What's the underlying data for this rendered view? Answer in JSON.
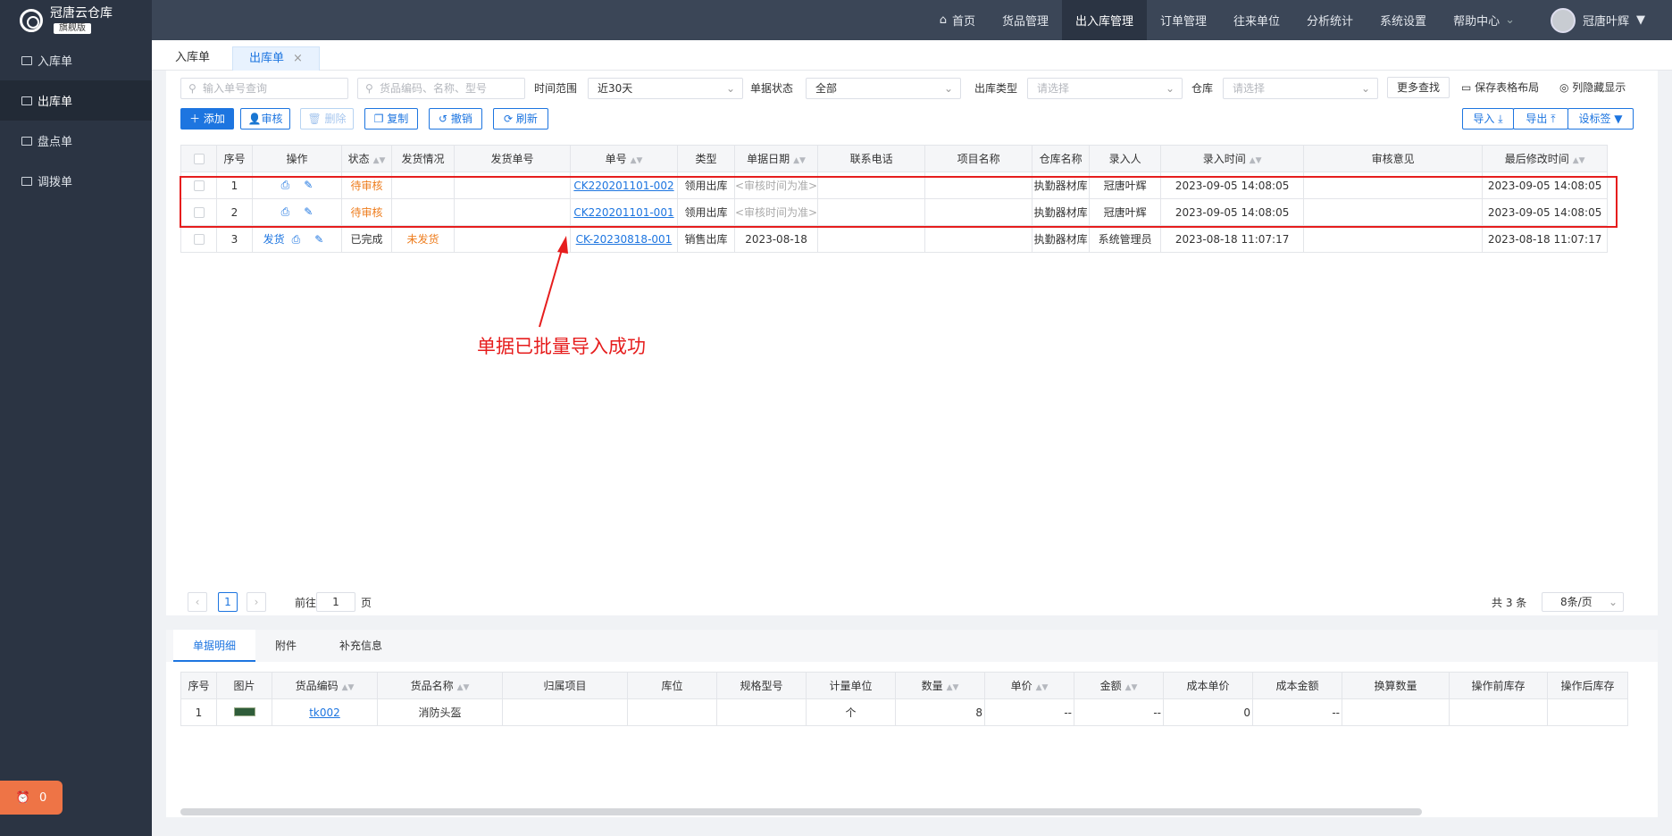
{
  "app": {
    "name": "冠唐云仓库",
    "edition": "旗舰版"
  },
  "sidebar": {
    "items": [
      {
        "label": "入库单"
      },
      {
        "label": "出库单"
      },
      {
        "label": "盘点单"
      },
      {
        "label": "调拨单"
      }
    ]
  },
  "float_badge": {
    "count": "0"
  },
  "topnav": {
    "items": [
      {
        "label": "首页"
      },
      {
        "label": "货品管理"
      },
      {
        "label": "出入库管理"
      },
      {
        "label": "订单管理"
      },
      {
        "label": "往来单位"
      },
      {
        "label": "分析统计"
      },
      {
        "label": "系统设置"
      },
      {
        "label": "帮助中心"
      }
    ],
    "user": "冠唐叶辉"
  },
  "tabs": [
    {
      "label": "入库单"
    },
    {
      "label": "出库单"
    }
  ],
  "filters": {
    "order_no_placeholder": "输入单号查询",
    "goods_placeholder": "货品编码、名称、型号",
    "time_label": "时间范围",
    "time_value": "近30天",
    "status_label": "单据状态",
    "status_value": "全部",
    "type_label": "出库类型",
    "type_placeholder": "请选择",
    "wh_label": "仓库",
    "wh_placeholder": "请选择",
    "more": "更多查找",
    "save_layout": "保存表格布局",
    "toggle_cols": "列隐藏显示"
  },
  "toolbar": {
    "add": "添加",
    "audit": "审核",
    "delete": "删除",
    "copy": "复制",
    "revoke": "撤销",
    "refresh": "刷新",
    "import": "导入",
    "export": "导出",
    "set_tag": "设标签"
  },
  "table": {
    "headers": [
      "序号",
      "操作",
      "状态",
      "发货情况",
      "发货单号",
      "单号",
      "类型",
      "单据日期",
      "联系电话",
      "项目名称",
      "仓库名称",
      "录入人",
      "录入时间",
      "审核意见",
      "最后修改时间"
    ],
    "rows": [
      {
        "idx": "1",
        "op_ship": "",
        "status": "待审核",
        "ship": "",
        "ship_no": "",
        "no": "CK220201101-002",
        "type": "领用出库",
        "date": "<审核时间为准>",
        "phone": "",
        "project": "",
        "wh": "执勤器材库",
        "creator": "冠唐叶辉",
        "ctime": "2023-09-05 14:08:05",
        "audit": "",
        "mtime": "2023-09-05 14:08:05"
      },
      {
        "idx": "2",
        "op_ship": "",
        "status": "待审核",
        "ship": "",
        "ship_no": "",
        "no": "CK220201101-001",
        "type": "领用出库",
        "date": "<审核时间为准>",
        "phone": "",
        "project": "",
        "wh": "执勤器材库",
        "creator": "冠唐叶辉",
        "ctime": "2023-09-05 14:08:05",
        "audit": "",
        "mtime": "2023-09-05 14:08:05"
      },
      {
        "idx": "3",
        "op_ship": "发货",
        "status": "已完成",
        "ship": "未发货",
        "ship_no": "",
        "no": "CK-20230818-001",
        "type": "销售出库",
        "date": "2023-08-18",
        "phone": "",
        "project": "",
        "wh": "执勤器材库",
        "creator": "系统管理员",
        "ctime": "2023-08-18 11:07:17",
        "audit": "",
        "mtime": "2023-08-18 11:07:17"
      }
    ]
  },
  "annotation": "单据已批量导入成功",
  "pager": {
    "current": "1",
    "goto_prefix": "前往",
    "goto_value": "1",
    "goto_suffix": "页",
    "total": "共 3 条",
    "page_size": "8条/页"
  },
  "detail": {
    "tabs": [
      "单据明细",
      "附件",
      "补充信息"
    ],
    "headers": [
      "序号",
      "图片",
      "货品编码",
      "货品名称",
      "归属项目",
      "库位",
      "规格型号",
      "计量单位",
      "数量",
      "单价",
      "金额",
      "成本单价",
      "成本金额",
      "换算数量",
      "操作前库存",
      "操作后库存"
    ],
    "rows": [
      {
        "idx": "1",
        "code": "tk002",
        "name": "消防头盔",
        "project": "",
        "loc": "",
        "spec": "",
        "unit": "个",
        "qty": "8",
        "price": "--",
        "amount": "--",
        "cost_price": "0",
        "cost_amount": "--",
        "conv": "",
        "before": "",
        "after": ""
      }
    ]
  }
}
